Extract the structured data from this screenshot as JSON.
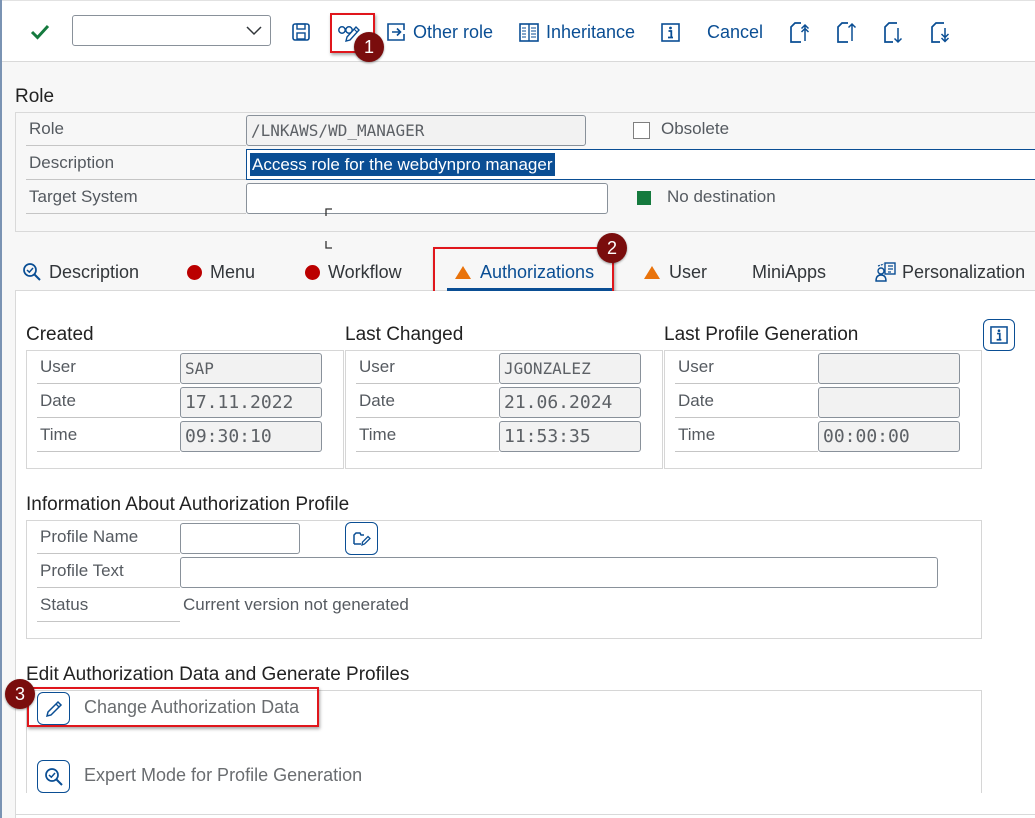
{
  "toolbar": {
    "combo_value": "",
    "other_role_label": "Other role",
    "inheritance_label": "Inheritance",
    "cancel_label": "Cancel",
    "icons": [
      "checkmark-icon",
      "save-icon",
      "display-change-icon",
      "other-role-icon",
      "inheritance-icon",
      "info-icon",
      "first-page-icon",
      "previous-page-icon",
      "next-page-icon",
      "last-page-icon"
    ]
  },
  "annotations": {
    "badge1": "1",
    "badge2": "2",
    "badge3": "3"
  },
  "role_section": {
    "title": "Role",
    "role_label": "Role",
    "role_value": "/LNKAWS/WD_MANAGER",
    "obsolete_label": "Obsolete",
    "obsolete_checked": false,
    "description_label": "Description",
    "description_value": "Access role for the webdynpro manager",
    "target_system_label": "Target System",
    "target_system_value": "",
    "destination_status": "No destination",
    "destination_status_color": "#157a3e"
  },
  "tabs": [
    {
      "label": "Description",
      "icon": "display-icon",
      "active": false
    },
    {
      "label": "Menu",
      "icon": "red-status-icon",
      "active": false
    },
    {
      "label": "Workflow",
      "icon": "red-status-icon",
      "active": false
    },
    {
      "label": "Authorizations",
      "icon": "warning-triangle-icon",
      "active": true
    },
    {
      "label": "User",
      "icon": "warning-triangle-icon",
      "active": false
    },
    {
      "label": "MiniApps",
      "icon": "",
      "active": false
    },
    {
      "label": "Personalization",
      "icon": "personalization-icon",
      "active": false
    }
  ],
  "authorizations": {
    "created": {
      "title": "Created",
      "user_label": "User",
      "user_value": "SAP",
      "date_label": "Date",
      "date_value": "17.11.2022",
      "time_label": "Time",
      "time_value": "09:30:10"
    },
    "last_changed": {
      "title": "Last Changed",
      "user_label": "User",
      "user_value": "JGONZALEZ",
      "date_label": "Date",
      "date_value": "21.06.2024",
      "time_label": "Time",
      "time_value": "11:53:35"
    },
    "last_profile_generation": {
      "title": "Last Profile Generation",
      "user_label": "User",
      "user_value": "",
      "date_label": "Date",
      "date_value": "",
      "time_label": "Time",
      "time_value": "00:00:00"
    },
    "profile_info": {
      "title": "Information About Authorization Profile",
      "profile_name_label": "Profile Name",
      "profile_name_value": "",
      "profile_text_label": "Profile Text",
      "profile_text_value": "",
      "status_label": "Status",
      "status_value": "Current version not generated"
    },
    "edit_section": {
      "title": "Edit Authorization Data and Generate Profiles",
      "change_auth_label": "Change Authorization Data",
      "expert_mode_label": "Expert Mode for Profile Generation"
    }
  },
  "colors": {
    "accent": "#0a4e94",
    "error": "#bb0000",
    "warning": "#e9730c",
    "success": "#157a3e",
    "callout": "#e0161c",
    "badge": "#7a0d0d"
  }
}
